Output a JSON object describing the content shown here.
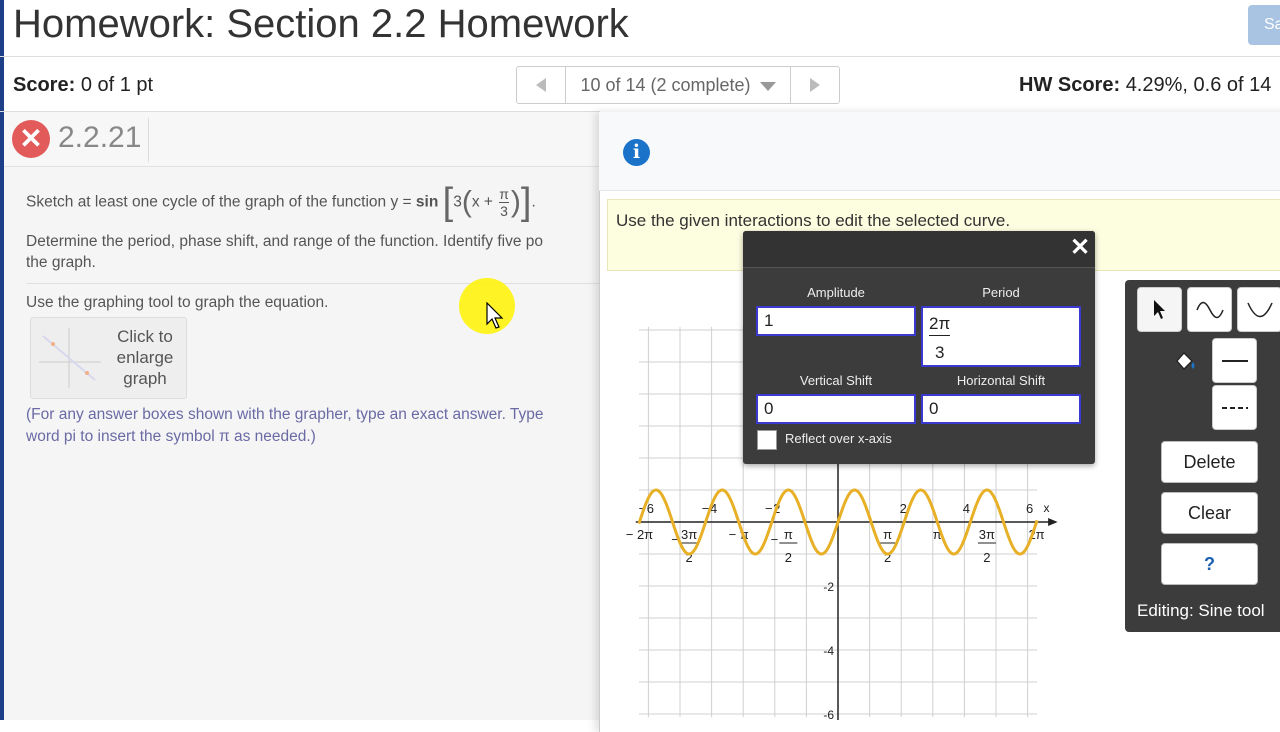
{
  "header": {
    "title": "Homework: Section 2.2 Homework",
    "save_label": "Sa",
    "score_label": "Score:",
    "score_value": "0 of 1 pt",
    "nav_position": "10 of 14 (2 complete)",
    "hw_score_label": "HW Score:",
    "hw_score_value": "4.29%, 0.6 of 14"
  },
  "question": {
    "number": "2.2.21",
    "prompt_prefix": "Sketch at least one cycle of the graph of the function y =",
    "fn_name": "sin",
    "fn_coef": "3",
    "fn_var": "x +",
    "fn_num": "π",
    "fn_den": "3",
    "fn_end": ".",
    "line2": "Determine the period, phase shift, and range of the function. Identify five po",
    "line3": "the graph.",
    "tool_instruction": "Use the graphing tool to graph the equation.",
    "thumbnail_text": "Click to enlarge graph",
    "note_line1": "(For any answer boxes shown with the grapher, type an exact answer. Type",
    "note_line2": "word pi to insert the symbol π as needed.)"
  },
  "panel": {
    "hint": "Use the given interactions to edit the selected curve.",
    "close_icon": "×"
  },
  "dialog": {
    "amplitude_label": "Amplitude",
    "amplitude_value": "1",
    "period_label": "Period",
    "period_num": "2π",
    "period_den": "3",
    "vshift_label": "Vertical Shift",
    "vshift_value": "0",
    "hshift_label": "Horizontal Shift",
    "hshift_value": "0",
    "reflect_label": "Reflect over x-axis",
    "close": "✕"
  },
  "toolbar": {
    "delete_label": "Delete",
    "clear_label": "Clear",
    "help_label": "?",
    "editing_status": "Editing: Sine tool"
  },
  "graph": {
    "x_tick_labels": [
      "6",
      "4",
      "2",
      "2",
      "4",
      "6"
    ],
    "x_neg_marks": [
      "−",
      "−",
      "−"
    ],
    "x_axis_label": "x",
    "y_tick_labels": [
      "-2",
      "-4",
      "-6"
    ],
    "pi_labels": [
      "− 2π",
      "− π",
      "π",
      "2π"
    ],
    "pi_frac_labels": [
      {
        "sign": "−",
        "num": "3π",
        "den": "2"
      },
      {
        "sign": "−",
        "num": "π",
        "den": "2"
      },
      {
        "sign": "",
        "num": "π",
        "den": "2"
      },
      {
        "sign": "",
        "num": "3π",
        "den": "2"
      }
    ],
    "curve": {
      "amplitude": 1,
      "period": 2.0944,
      "phase": 0,
      "x_range": [
        -6.3,
        6.3
      ]
    },
    "curve_color": "#e8b026"
  }
}
